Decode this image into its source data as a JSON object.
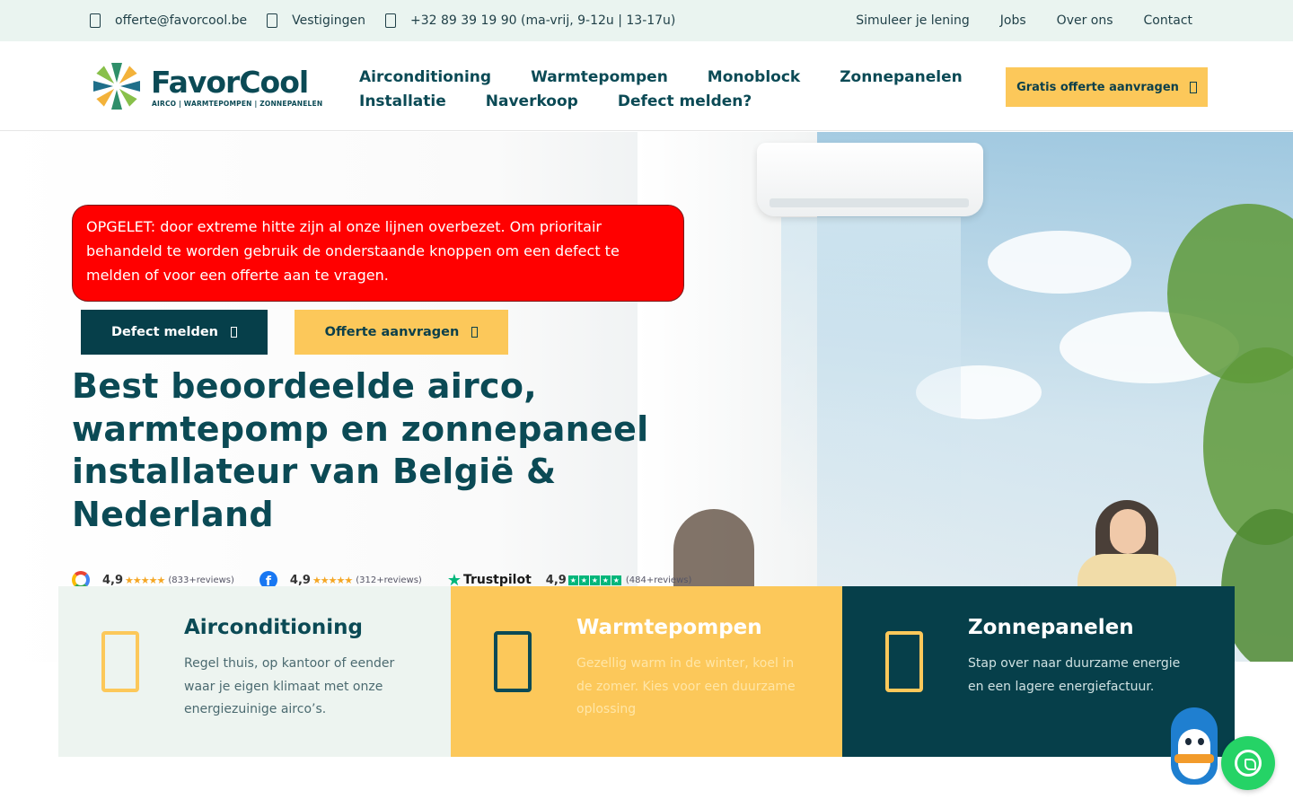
{
  "topbar": {
    "email": "offerte@favorcool.be",
    "locations": "Vestigingen",
    "phone": "+32 89 39 19 90 (ma-vrij, 9-12u | 13-17u)",
    "links": [
      "Simuleer je lening",
      "Jobs",
      "Over ons",
      "Contact"
    ]
  },
  "header": {
    "logo_word": "FavorCool",
    "logo_tagline": "AIRCO | WARMTEPOMPEN | ZONNEPANELEN",
    "nav_row1": [
      "Airconditioning",
      "Warmtepompen",
      "Monoblock",
      "Zonnepanelen"
    ],
    "nav_row2": [
      "Installatie",
      "Naverkoop",
      "Defect melden?"
    ],
    "cta": "Gratis offerte aanvragen"
  },
  "hero": {
    "alert": "OPGELET: door extreme hitte zijn al onze lijnen overbezet. Om prioritair behandeld te worden gebruik de onderstaande knoppen om een defect te melden of voor een offerte aan te vragen.",
    "btn_defect": "Defect melden",
    "btn_offerte": "Offerte aanvragen",
    "headline": "Best beoordeelde airco, warmtepomp en zonnepaneel installateur van België & Nederland",
    "reviews": [
      {
        "source": "google",
        "score": "4,9",
        "count": "(833+reviews)"
      },
      {
        "source": "facebook",
        "score": "4,9",
        "count": "(312+reviews)"
      },
      {
        "source": "trustpilot",
        "label": "Trustpilot",
        "score": "4,9",
        "count": "(484+reviews)"
      }
    ]
  },
  "cards": [
    {
      "title": "Airconditioning",
      "text": "Regel thuis, op kantoor of eender waar je eigen klimaat met onze energiezuinige airco’s."
    },
    {
      "title": "Warmtepompen",
      "text": "Gezellig warm in de winter, koel in de zomer. Kies voor een duurzame oplossing"
    },
    {
      "title": "Zonnepanelen",
      "text": "Stap over naar duurzame energie en een lagere energiefactuur."
    }
  ],
  "colors": {
    "brand_dark": "#063f4a",
    "brand_yellow": "#fcc85a",
    "alert_red": "#ff0000",
    "topbar_bg": "#eaf4f0",
    "whatsapp_green": "#25d366"
  },
  "icons": [
    "mail-icon",
    "map-pin-icon",
    "phone-icon",
    "arrow-right-icon",
    "google-logo",
    "facebook-logo",
    "trustpilot-logo",
    "snowflake-icon",
    "heat-pump-icon",
    "solar-panel-icon",
    "whatsapp-icon",
    "penguin-chatbot-icon"
  ]
}
